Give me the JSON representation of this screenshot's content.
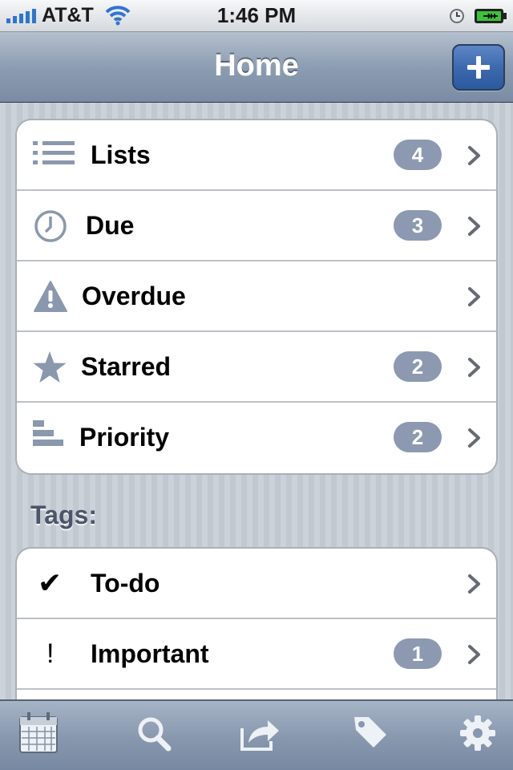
{
  "status_bar": {
    "carrier": "AT&T",
    "time": "1:46 PM"
  },
  "nav": {
    "title": "Home",
    "add_icon": "plus-icon"
  },
  "home_rows": [
    {
      "label": "Lists",
      "badge": "4",
      "icon": "list-icon"
    },
    {
      "label": "Due",
      "badge": "3",
      "icon": "clock-icon"
    },
    {
      "label": "Overdue",
      "badge": "",
      "icon": "warning-icon"
    },
    {
      "label": "Starred",
      "badge": "2",
      "icon": "star-icon"
    },
    {
      "label": "Priority",
      "badge": "2",
      "icon": "priority-bars-icon"
    }
  ],
  "tags": {
    "header": "Tags:",
    "rows": [
      {
        "label": "To-do",
        "badge": "",
        "glyph": "✔"
      },
      {
        "label": "Important",
        "badge": "1",
        "glyph": "!"
      }
    ]
  },
  "tabbar": {
    "icons": [
      "calendar-icon",
      "search-icon",
      "share-icon",
      "tag-icon",
      "gear-icon"
    ]
  },
  "colors": {
    "nav_bar": "#8c9db2",
    "badge": "#8c99b0",
    "add_button": "#3d69ae",
    "icon_gray": "#8a98ad"
  }
}
